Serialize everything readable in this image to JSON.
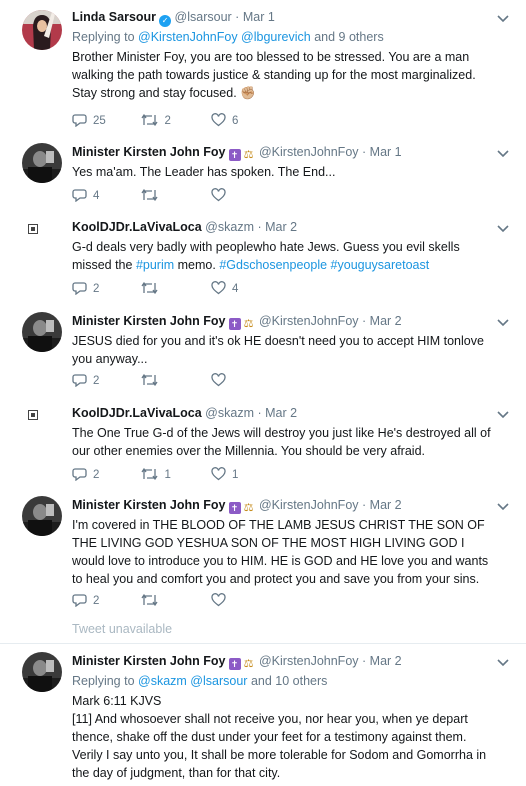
{
  "tweets": [
    {
      "name": "Linda Sarsour",
      "handle": "@lsarsour",
      "date": "Mar 1",
      "replying_prefix": "Replying to",
      "replying_handles": "@KirstenJohnFoy @lbgurevich",
      "replying_suffix": "and 9 others",
      "text": "Brother Minister Foy, you are too blessed to be stressed. You are a man walking the path towards justice & standing up for the most marginalized. Stay strong and stay focused. ✊🏼",
      "replies": "25",
      "retweets": "2",
      "likes": "6"
    },
    {
      "name": "Minister Kirsten John Foy",
      "handle": "@KirstenJohnFoy",
      "date": "Mar 1",
      "text": "Yes ma'am. The Leader has spoken. The End...",
      "replies": "4",
      "retweets": "",
      "likes": ""
    },
    {
      "name": "KoolDJDr.LaVivaLoca",
      "handle": "@skazm",
      "date": "Mar 2",
      "text_plain": "G-d deals very badly with peoplewho hate Jews. Guess you evil skells missed the",
      "hashtag_purim": "#purim",
      "text_memo": "memo.",
      "hashtag_chosen": "#Gdschosenpeople",
      "hashtag_toast": "#youguysaretoast",
      "replies": "2",
      "retweets": "",
      "likes": "4"
    },
    {
      "name": "Minister Kirsten John Foy",
      "handle": "@KirstenJohnFoy",
      "date": "Mar 2",
      "text": "JESUS died for you and it's ok HE doesn't need you to accept HIM tonlove you anyway...",
      "replies": "2",
      "retweets": "",
      "likes": ""
    },
    {
      "name": "KoolDJDr.LaVivaLoca",
      "handle": "@skazm",
      "date": "Mar 2",
      "text": "The One True G-d of the Jews will destroy you just like He's destroyed all of our other enemies over the Millennia. You should be very afraid.",
      "replies": "2",
      "retweets": "1",
      "likes": "1"
    },
    {
      "name": "Minister Kirsten John Foy",
      "handle": "@KirstenJohnFoy",
      "date": "Mar 2",
      "text": "I'm covered in THE BLOOD OF THE LAMB JESUS CHRIST THE SON OF THE LIVING GOD YESHUA SON OF THE MOST HIGH LIVING GOD I would love to introduce you to HIM. HE is GOD and HE love you and wants to heal you and comfort you and protect you and save you from your sins.",
      "replies": "2",
      "retweets": "",
      "likes": ""
    },
    {
      "name": "Minister Kirsten John Foy",
      "handle": "@KirstenJohnFoy",
      "date": "Mar 2",
      "replying_prefix": "Replying to",
      "replying_handles": "@skazm @lsarsour",
      "replying_suffix": "and 10 others",
      "text_line1": "Mark 6:11 KJVS",
      "text_line2": "[11] And whosoever shall not receive you, nor hear you, when ye depart thence, shake off the dust under your feet for a testimony against them. Verily I say unto you, It shall be more tolerable for Sodom and Gomorrha in the day of judgment, than for that city."
    }
  ],
  "tweet_unavailable": "Tweet unavailable",
  "icons": {
    "reply": "reply-icon",
    "retweet": "retweet-icon",
    "like": "heart-icon",
    "more": "chevron-down-icon",
    "verified": "verified-icon",
    "cross_badge": "cross-icon",
    "scales_badge": "scales-icon",
    "broken_image": "broken-image-icon"
  },
  "colors": {
    "link": "#1b95e0",
    "secondary_text": "#657786",
    "divider": "#e6ecf0",
    "verified": "#1da1f2",
    "cross_badge": "#8c5bc6"
  },
  "dot": "·"
}
